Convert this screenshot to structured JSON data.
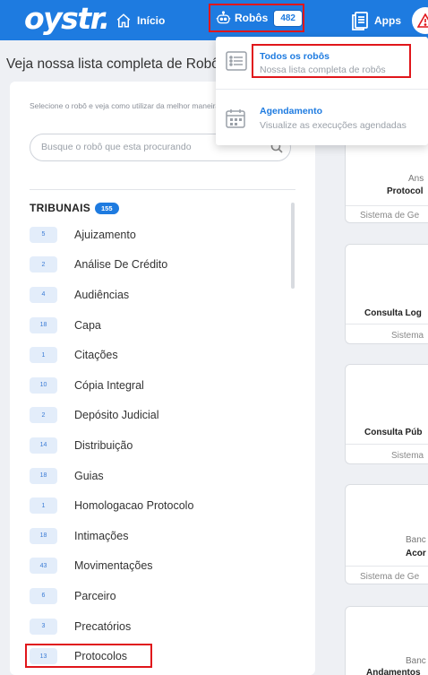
{
  "brand": {
    "logo_text": "oystr."
  },
  "nav": {
    "home_label": "Início",
    "robots_label": "Robôs",
    "robots_count": "482",
    "apps_label": "Apps"
  },
  "page": {
    "title": "Veja nossa lista completa de Robôs"
  },
  "left_panel": {
    "subtitle": "Selecione o robô e veja como utilizar da melhor maneira",
    "search_placeholder": "Busque o robô que esta procurando",
    "section_title": "TRIBUNAIS",
    "section_count": "155",
    "categories": [
      {
        "count": "5",
        "name": "Ajuizamento"
      },
      {
        "count": "2",
        "name": "Análise De Crédito"
      },
      {
        "count": "4",
        "name": "Audiências"
      },
      {
        "count": "18",
        "name": "Capa"
      },
      {
        "count": "1",
        "name": "Citações"
      },
      {
        "count": "10",
        "name": "Cópia Integral"
      },
      {
        "count": "2",
        "name": "Depósito Judicial"
      },
      {
        "count": "14",
        "name": "Distribuição"
      },
      {
        "count": "18",
        "name": "Guias"
      },
      {
        "count": "1",
        "name": "Homologacao Protocolo"
      },
      {
        "count": "18",
        "name": "Intimações"
      },
      {
        "count": "43",
        "name": "Movimentações"
      },
      {
        "count": "6",
        "name": "Parceiro"
      },
      {
        "count": "3",
        "name": "Precatórios"
      },
      {
        "count": "13",
        "name": "Protocolos"
      }
    ]
  },
  "right_cards": [
    {
      "line1": "Ans",
      "line2": "Protocol",
      "footer": "Sistema de Ge"
    },
    {
      "line1": "",
      "line2": "Consulta Log",
      "footer": "Sistema"
    },
    {
      "line1": "",
      "line2": "Consulta Púb",
      "footer": "Sistema"
    },
    {
      "line1": "Banc",
      "line2": "Acor",
      "footer": "Sistema de Ge"
    },
    {
      "line1": "Banc",
      "line2": "Andamentos",
      "footer": ""
    }
  ],
  "dropdown": {
    "items": [
      {
        "title": "Todos os robôs",
        "desc": "Nossa lista completa de robôs",
        "icon": "list-icon"
      },
      {
        "title": "Agendamento",
        "desc": "Visualize as execuções agendadas",
        "icon": "calendar-icon"
      }
    ]
  },
  "colors": {
    "primary": "#1e7be0",
    "highlight": "#e0161b",
    "badge_bg": "#e3edfa"
  }
}
